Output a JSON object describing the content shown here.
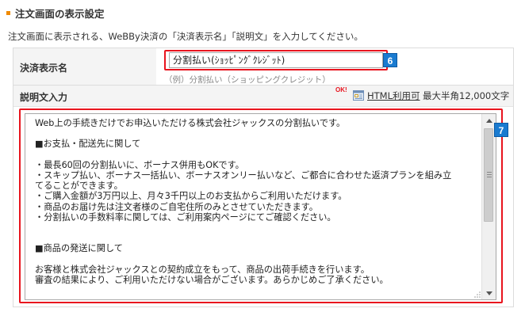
{
  "section": {
    "title": "注文画面の表示設定"
  },
  "description": "注文画面に表示される、WeBBy決済の「決済表示名」「説明文」を入力してください。",
  "fields": {
    "display_name": {
      "label": "決済表示名",
      "value": "分割払い(ｼｮｯﾋﾟﾝｸﾞｸﾚｼﾞｯﾄ)",
      "example": "（例）分割払い（ショッピングクレジット）",
      "marker": "6"
    },
    "description": {
      "label": "説明文入力",
      "ok_label": "OK!",
      "html_link": "HTML利用可",
      "limit": "最大半角12,000文字",
      "marker": "7",
      "lines": [
        "Web上の手続きだけでお申込いただける株式会社ジャックスの分割払いです。",
        "",
        "■お支払・配送先に関して",
        "",
        "・最長60回の分割払いに、ボーナス併用もOKです。",
        "・スキップ払い、ボーナス一括払い、ボーナスオンリー払いなど、ご都合に合わせた返済プランを組み立",
        "てることができます。",
        "・ご購入金額が3万円以上、月々3千円以上のお支払からご利用いただけます。",
        "・商品のお届け先は注文者様のご自宅住所のみとさせていただきます。",
        "・分割払いの手数料率に関しては、ご利用案内ページにてご確認ください。",
        "",
        "",
        "■商品の発送に関して",
        "",
        "お客様と株式会社ジャックスとの契約成立をもって、商品の出荷手続きを行います。",
        "審査の結果により、ご利用いただけない場合がございます。あらかじめご了承ください。"
      ]
    }
  },
  "colors": {
    "accent": "#f08a00",
    "highlight": "#e8141e",
    "marker": "#1a7bd0"
  }
}
